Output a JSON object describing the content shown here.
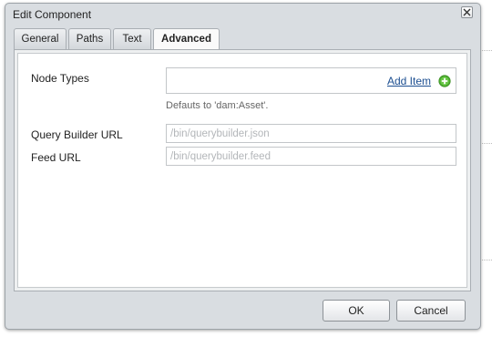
{
  "dialog": {
    "title": "Edit Component",
    "close_icon": "close-icon"
  },
  "tabs": [
    {
      "label": "General",
      "active": false
    },
    {
      "label": "Paths",
      "active": false
    },
    {
      "label": "Text",
      "active": false
    },
    {
      "label": "Advanced",
      "active": true
    }
  ],
  "fields": {
    "node_types": {
      "label": "Node Types",
      "add_item_label": "Add Item",
      "add_icon": "plus-circle-icon",
      "hint": "Defauts to 'dam:Asset'."
    },
    "query_builder_url": {
      "label": "Query Builder URL",
      "value": "",
      "placeholder": "/bin/querybuilder.json"
    },
    "feed_url": {
      "label": "Feed URL",
      "value": "",
      "placeholder": "/bin/querybuilder.feed"
    }
  },
  "buttons": {
    "ok": "OK",
    "cancel": "Cancel"
  },
  "colors": {
    "link": "#1d4f91",
    "add_icon": "#4caf2e",
    "dialog_bg": "#d9dde1"
  }
}
